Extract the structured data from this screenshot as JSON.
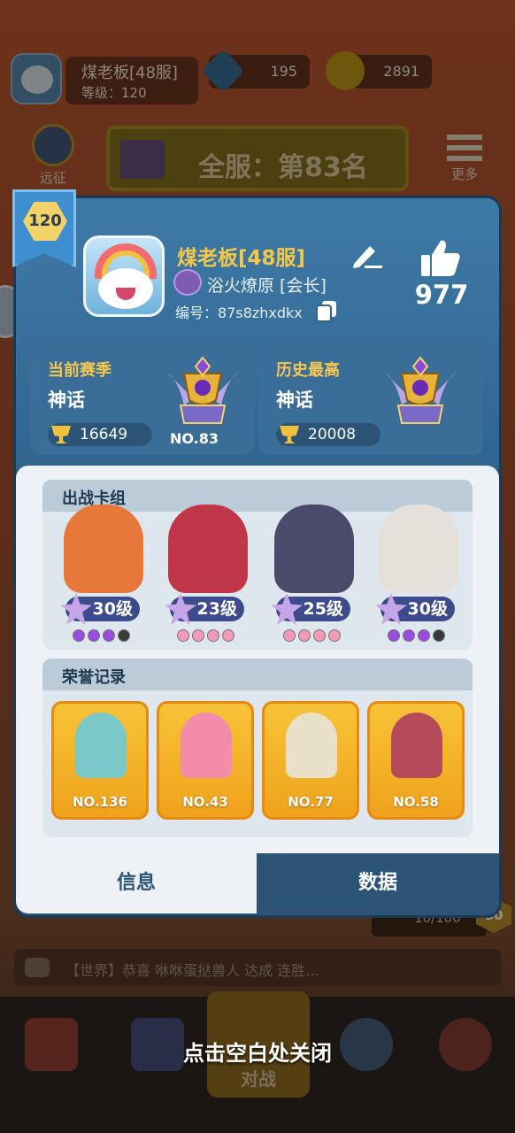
{
  "background": {
    "player_name": "煤老板[48服]",
    "player_level": "等级：120",
    "gems": "195",
    "coins": "2891",
    "expedition_label": "远征",
    "rank_banner": "全服：第83名",
    "more_label": "更多",
    "xp_text": "10/100",
    "xp_level": "80",
    "chat_text": "【世界】恭喜 咻咻蛋挞兽人 达成 连胜...",
    "battle_label": "对战",
    "close_hint": "点击空白处关闭"
  },
  "profile": {
    "level": "120",
    "name": "煤老板[48服]",
    "guild": "浴火燎原 [会长]",
    "id_text": "编号：87s8zhxdkx",
    "likes": "977",
    "current_season": {
      "label": "当前赛季",
      "rank": "神话",
      "trophies": "16649",
      "badge_no": "NO.83"
    },
    "best_season": {
      "label": "历史最高",
      "rank": "神话",
      "trophies": "20008"
    }
  },
  "deck": {
    "title": "出战卡组",
    "cards": [
      {
        "name": "fire-brawler",
        "level": "30级",
        "color": "#e8773a",
        "dots": [
          "purple",
          "purple",
          "purple",
          "dark"
        ]
      },
      {
        "name": "mech-warrior",
        "level": "23级",
        "color": "#c0374a",
        "dots": [
          "pink",
          "pink",
          "pink",
          "pink"
        ]
      },
      {
        "name": "armored-robot",
        "level": "25级",
        "color": "#4a4a6a",
        "dots": [
          "pink",
          "pink",
          "pink",
          "pink"
        ]
      },
      {
        "name": "bearded-dwarf",
        "level": "30级",
        "color": "#e6e0da",
        "dots": [
          "purple",
          "purple",
          "purple",
          "dark"
        ]
      }
    ]
  },
  "honors": {
    "title": "荣誉记录",
    "items": [
      {
        "name": "skull-trophy",
        "no": "NO.136",
        "color": "#7ac8c8"
      },
      {
        "name": "ice-cream-trophy",
        "no": "NO.43",
        "color": "#f28ca8"
      },
      {
        "name": "serpent-trophy",
        "no": "NO.77",
        "color": "#e9e0c8"
      },
      {
        "name": "winged-cup-trophy",
        "no": "NO.58",
        "color": "#b44a5a"
      }
    ]
  },
  "tabs": {
    "info": "信息",
    "data": "数据"
  }
}
